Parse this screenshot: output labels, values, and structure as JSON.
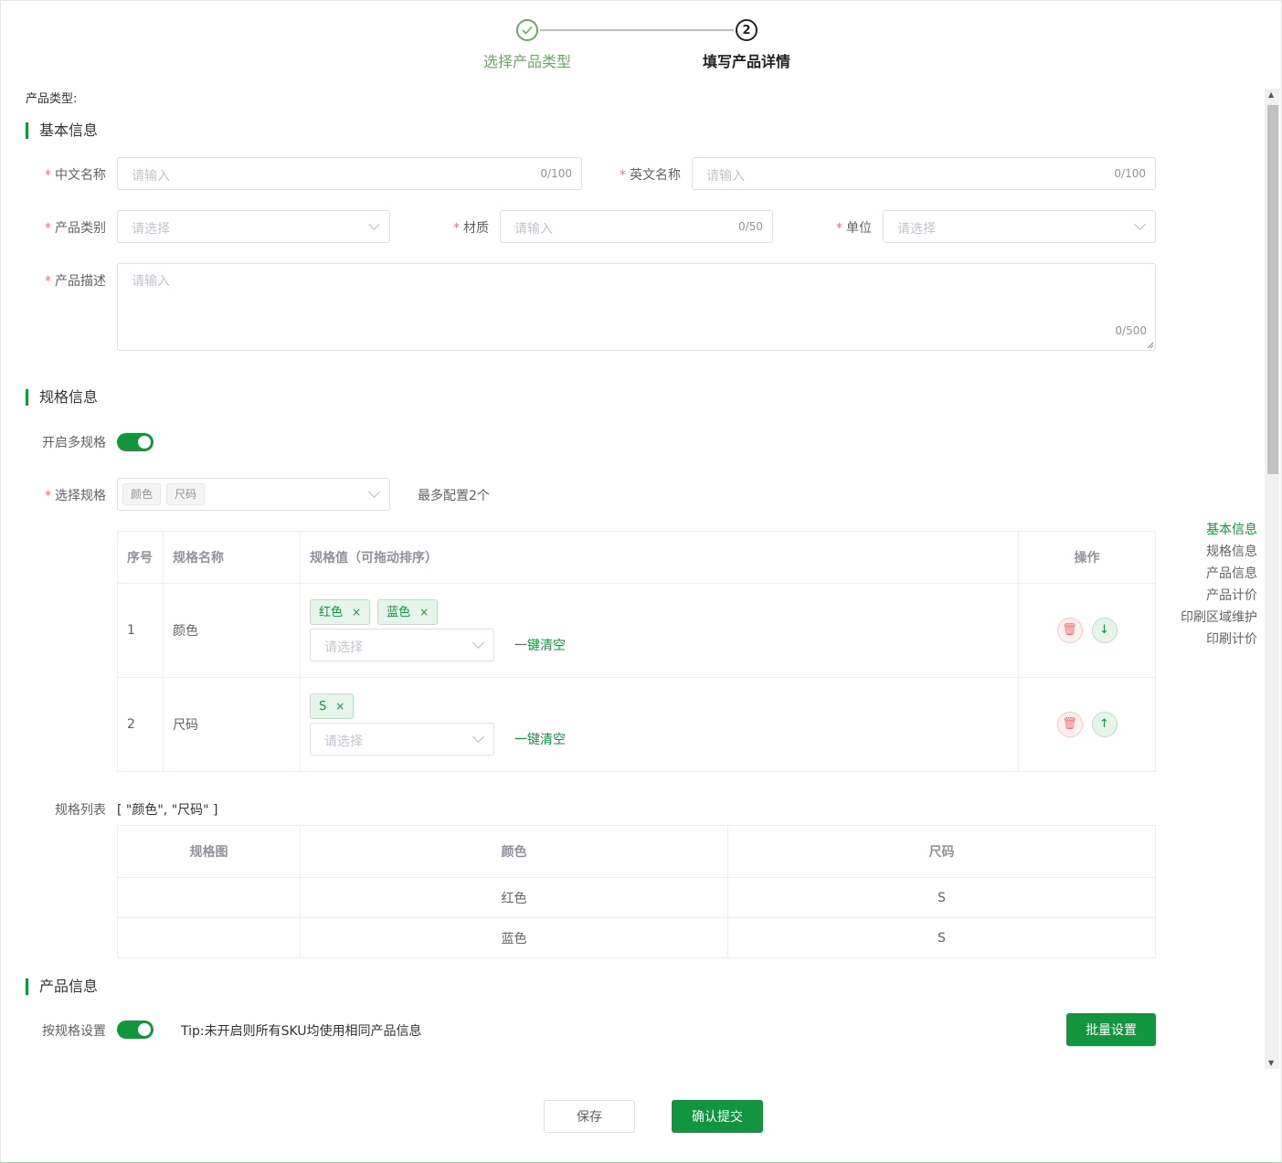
{
  "steps": [
    {
      "label": "选择产品类型",
      "status": "done"
    },
    {
      "label": "填写产品详情",
      "number": "2",
      "status": "active"
    }
  ],
  "product_type_label": "产品类型:",
  "sections": {
    "basic": "基本信息",
    "spec": "规格信息",
    "product": "产品信息"
  },
  "fields": {
    "cn_name": {
      "label": "中文名称",
      "placeholder": "请输入",
      "count": "0/100"
    },
    "en_name": {
      "label": "英文名称",
      "placeholder": "请输入",
      "count": "0/100"
    },
    "category": {
      "label": "产品类别",
      "placeholder": "请选择"
    },
    "material": {
      "label": "材质",
      "placeholder": "请输入",
      "count": "0/50"
    },
    "unit": {
      "label": "单位",
      "placeholder": "请选择"
    },
    "desc": {
      "label": "产品描述",
      "placeholder": "请输入",
      "count": "0/500"
    }
  },
  "multi_spec": {
    "label": "开启多规格",
    "on": true
  },
  "select_spec": {
    "label": "选择规格",
    "tags": [
      "颜色",
      "尺码"
    ],
    "hint": "最多配置2个"
  },
  "spec_table": {
    "headers": [
      "序号",
      "规格名称",
      "规格值（可拖动排序）",
      "操作"
    ],
    "rows": [
      {
        "index": "1",
        "name": "颜色",
        "values": [
          "红色",
          "蓝色"
        ],
        "placeholder": "请选择",
        "clear": "一键清空"
      },
      {
        "index": "2",
        "name": "尺码",
        "values": [
          "S"
        ],
        "placeholder": "请选择",
        "clear": "一键清空"
      }
    ]
  },
  "spec_list": {
    "label": "规格列表",
    "value": "[ \"颜色\", \"尺码\" ]",
    "headers": [
      "规格图",
      "颜色",
      "尺码"
    ],
    "rows": [
      [
        "",
        "红色",
        "S"
      ],
      [
        "",
        "蓝色",
        "S"
      ]
    ]
  },
  "by_spec": {
    "label": "按规格设置",
    "on": true,
    "tip": "Tip:未开启则所有SKU均使用相同产品信息",
    "batch_button": "批量设置"
  },
  "anchors": [
    "基本信息",
    "规格信息",
    "产品信息",
    "产品计价",
    "印刷区域维护",
    "印刷计价"
  ],
  "footer": {
    "save": "保存",
    "submit": "确认提交"
  },
  "colors": {
    "primary": "#11953d",
    "step_done": "#6ba865",
    "danger": "#f56c6c"
  }
}
